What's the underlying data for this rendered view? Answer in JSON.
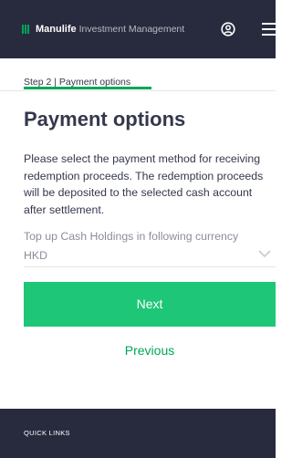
{
  "header": {
    "brand_strong": "Manulife",
    "brand_light": "Investment Management",
    "icons": {
      "user": "user-icon",
      "menu": "hamburger-menu-icon"
    }
  },
  "step": {
    "label": "Step 2 | Payment options"
  },
  "main": {
    "title": "Payment options",
    "description": "Please select the payment method for receiving redemption proceeds. The redemption proceeds will be deposited to the selected cash account after settlement.",
    "currency_label": "Top up Cash Holdings in following currency",
    "currency_value": "HKD"
  },
  "actions": {
    "next_label": "Next",
    "previous_label": "Previous"
  },
  "footer": {
    "title": "QUICK LINKS"
  },
  "colors": {
    "header_bg": "#282b3e",
    "brand_green": "#00a758",
    "button_green": "#1ec677",
    "text": "#34384b",
    "muted_text": "#8b8e9a"
  }
}
